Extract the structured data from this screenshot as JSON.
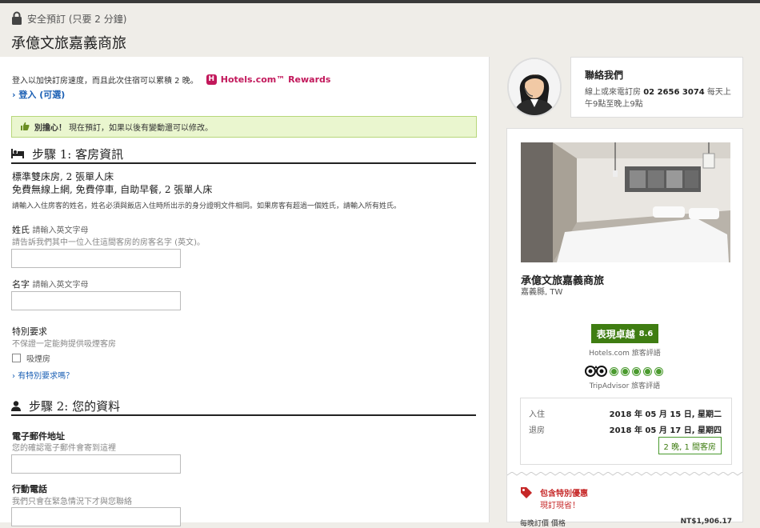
{
  "header": {
    "secure_text": "安全預訂 (只要 2 分鐘)",
    "hotel_name": "承億文旅嘉義商旅"
  },
  "main": {
    "rewards_text": "登入以加快訂房速度，而且此次住宿可以累積 2 晚。",
    "rewards_brand": "Hotels.com™ Rewards",
    "login_link": "登入 (可選)",
    "notice_bold": "別擔心！",
    "notice_text": "現在預訂，如果以後有變動還可以修改。",
    "step1_title": "步驟 1: 客房資訊",
    "room_name": "標準雙床房, 2 張單人床",
    "room_amenities": "免費無線上網, 免費停車, 自助早餐, 2 張單人床",
    "room_note": "請輸入入住房客的姓名，姓名必須與飯店入住時所出示的身分證明文件相同。如果房客有超過一個姓氏，請輸入所有姓氏。",
    "surname_label": "姓氏",
    "surname_sub": "請輸入英文字母",
    "surname_hint": "請告訴我們其中一位入住這間客房的房客名字 (英文)。",
    "firstname_label": "名字",
    "firstname_sub": "請輸入英文字母",
    "special_label": "特別要求",
    "special_hint": "不保證一定能夠提供吸煙客房",
    "smoking_label": "吸煙房",
    "special_link": "有特別要求嗎？",
    "step2_title": "步驟 2: 您的資料",
    "email_label": "電子郵件地址",
    "email_hint": "您的確認電子郵件會寄到這裡",
    "phone_label": "行動電話",
    "phone_hint": "我們只會在緊急情況下才與您聯絡"
  },
  "sidebar": {
    "contact_title": "聯絡我們",
    "contact_prefix": "線上或來電訂房",
    "contact_phone": "02 2656 3074",
    "contact_suffix": "每天上午9點至晚上9點",
    "hotel_name": "承億文旅嘉義商旅",
    "location": "嘉義縣, TW",
    "rating_label": "表現卓越",
    "rating_score": "8.6",
    "rating_source": "Hotels.com 旅客評語",
    "tripadvisor_source": "TripAdvisor 旅客評語",
    "tripadvisor_rating": 5,
    "checkin_label": "入住",
    "checkin_date": "2018 年 05 月 15 日, 星期二",
    "checkout_label": "退房",
    "checkout_date": "2018 年 05 月 17 日, 星期四",
    "nights": "2 晚, 1 間客房",
    "promo_title": "包含特別優惠",
    "promo_sub": "現訂現省！",
    "price_label": "每晚訂價 價格",
    "price_value": "NT$1,906.17"
  },
  "colors": {
    "accent_blue": "#1a5fb4",
    "rating_green": "#3f7d12",
    "promo_red": "#c62828",
    "rewards_pink": "#c2185b"
  }
}
